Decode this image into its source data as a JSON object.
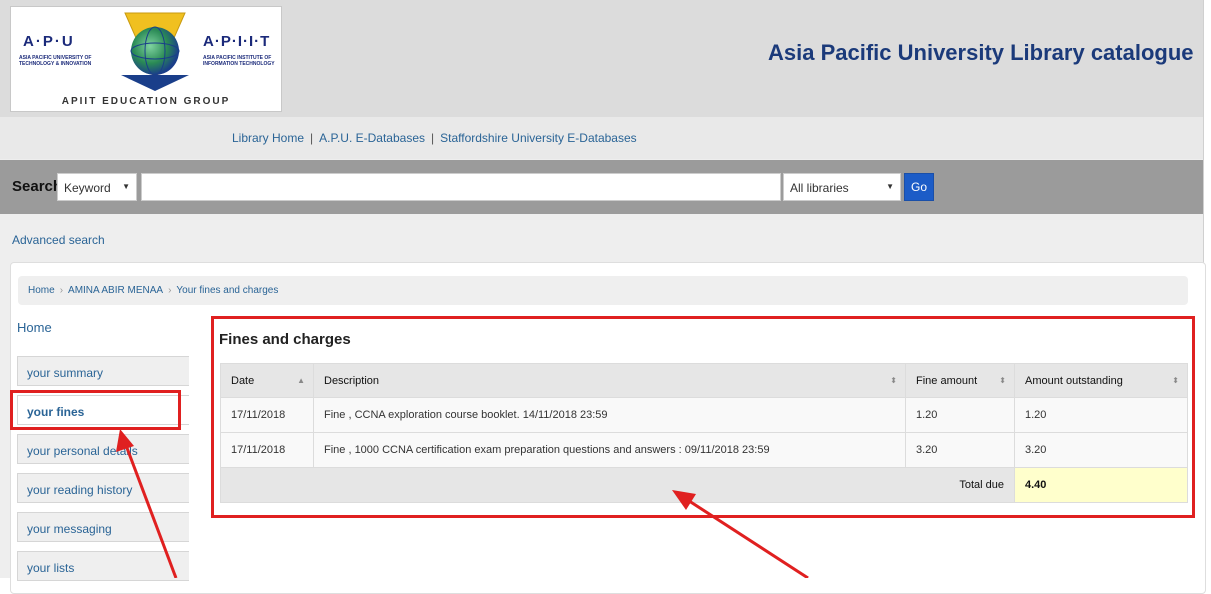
{
  "header": {
    "title": "Asia Pacific University Library catalogue",
    "logo": {
      "left_abbr": "A·P·U",
      "left_sub": "ASIA PACIFIC UNIVERSITY OF TECHNOLOGY & INNOVATION",
      "right_abbr": "A·P·I·I·T",
      "right_sub": "ASIA PACIFIC INSTITUTE OF INFORMATION TECHNOLOGY",
      "group": "APIIT EDUCATION GROUP"
    }
  },
  "nav": {
    "links": [
      "Library Home",
      "A.P.U. E-Databases",
      "Staffordshire University E-Databases"
    ],
    "separator": "|"
  },
  "search": {
    "label": "Search",
    "type_selected": "Keyword",
    "query": "",
    "library_selected": "All libraries",
    "go_label": "Go"
  },
  "advanced_search": "Advanced search",
  "breadcrumb": [
    "Home",
    "AMINA ABIR MENAA",
    "Your fines and charges"
  ],
  "sidebar": {
    "home": "Home",
    "items": [
      "your summary",
      "your fines",
      "your personal details",
      "your reading history",
      "your messaging",
      "your lists"
    ],
    "active": "your fines"
  },
  "fines": {
    "title": "Fines and charges",
    "columns": [
      "Date",
      "Description",
      "Fine amount",
      "Amount outstanding"
    ],
    "rows": [
      {
        "date": "17/11/2018",
        "description": "Fine , CCNA exploration course booklet. 14/11/2018 23:59",
        "amount": "1.20",
        "outstanding": "1.20"
      },
      {
        "date": "17/11/2018",
        "description": "Fine , 1000 CCNA certification exam preparation questions and answers : 09/11/2018 23:59",
        "amount": "3.20",
        "outstanding": "3.20"
      }
    ],
    "total_label": "Total due",
    "total_value": "4.40"
  },
  "colors": {
    "annotation": "#e02020",
    "link": "#2a6496",
    "go_button": "#1c5cc7",
    "total_highlight": "#ffffcc"
  }
}
